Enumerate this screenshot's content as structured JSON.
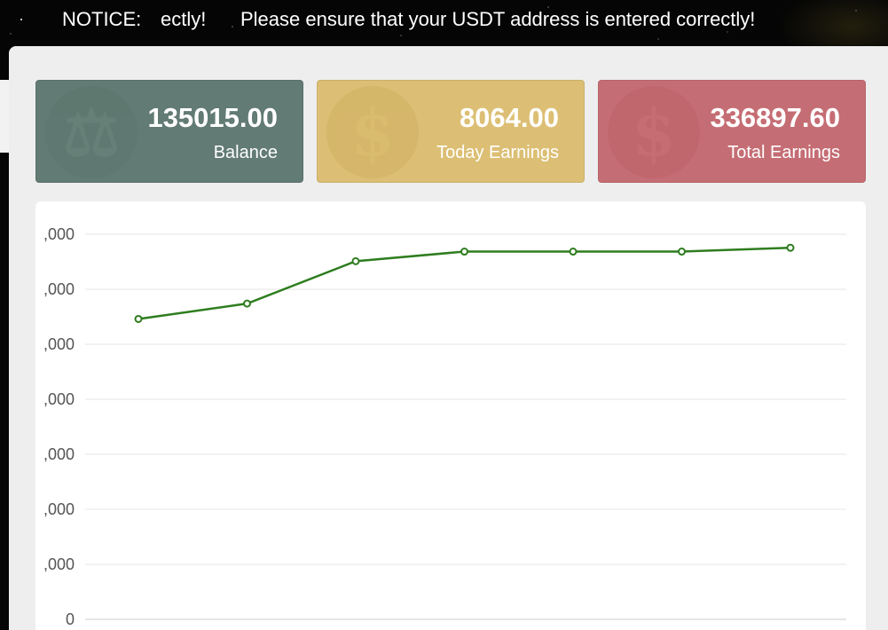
{
  "notice": {
    "label": "NOTICE:",
    "fragment": "ectly!",
    "message": "Please ensure that your USDT address is entered correctly!"
  },
  "cards": [
    {
      "value": "135015.00",
      "label": "Balance",
      "icon": "scale-icon",
      "color": "#627b74"
    },
    {
      "value": "8064.00",
      "label": "Today Earnings",
      "icon": "dollar-icon",
      "color": "#dcbf74"
    },
    {
      "value": "336897.60",
      "label": "Total Earnings",
      "icon": "dollar-icon",
      "color": "#c56d74"
    }
  ],
  "chart_data": {
    "type": "line",
    "y_tick_labels": [
      ",000",
      ",000",
      ",000",
      ",000",
      ",000",
      ",000",
      ",000",
      "0"
    ],
    "series_color": "#2e7d1f",
    "values_relative_to_top_gridline": [
      0.78,
      0.82,
      0.93,
      0.955,
      0.955,
      0.955,
      0.965
    ],
    "grid": true
  }
}
